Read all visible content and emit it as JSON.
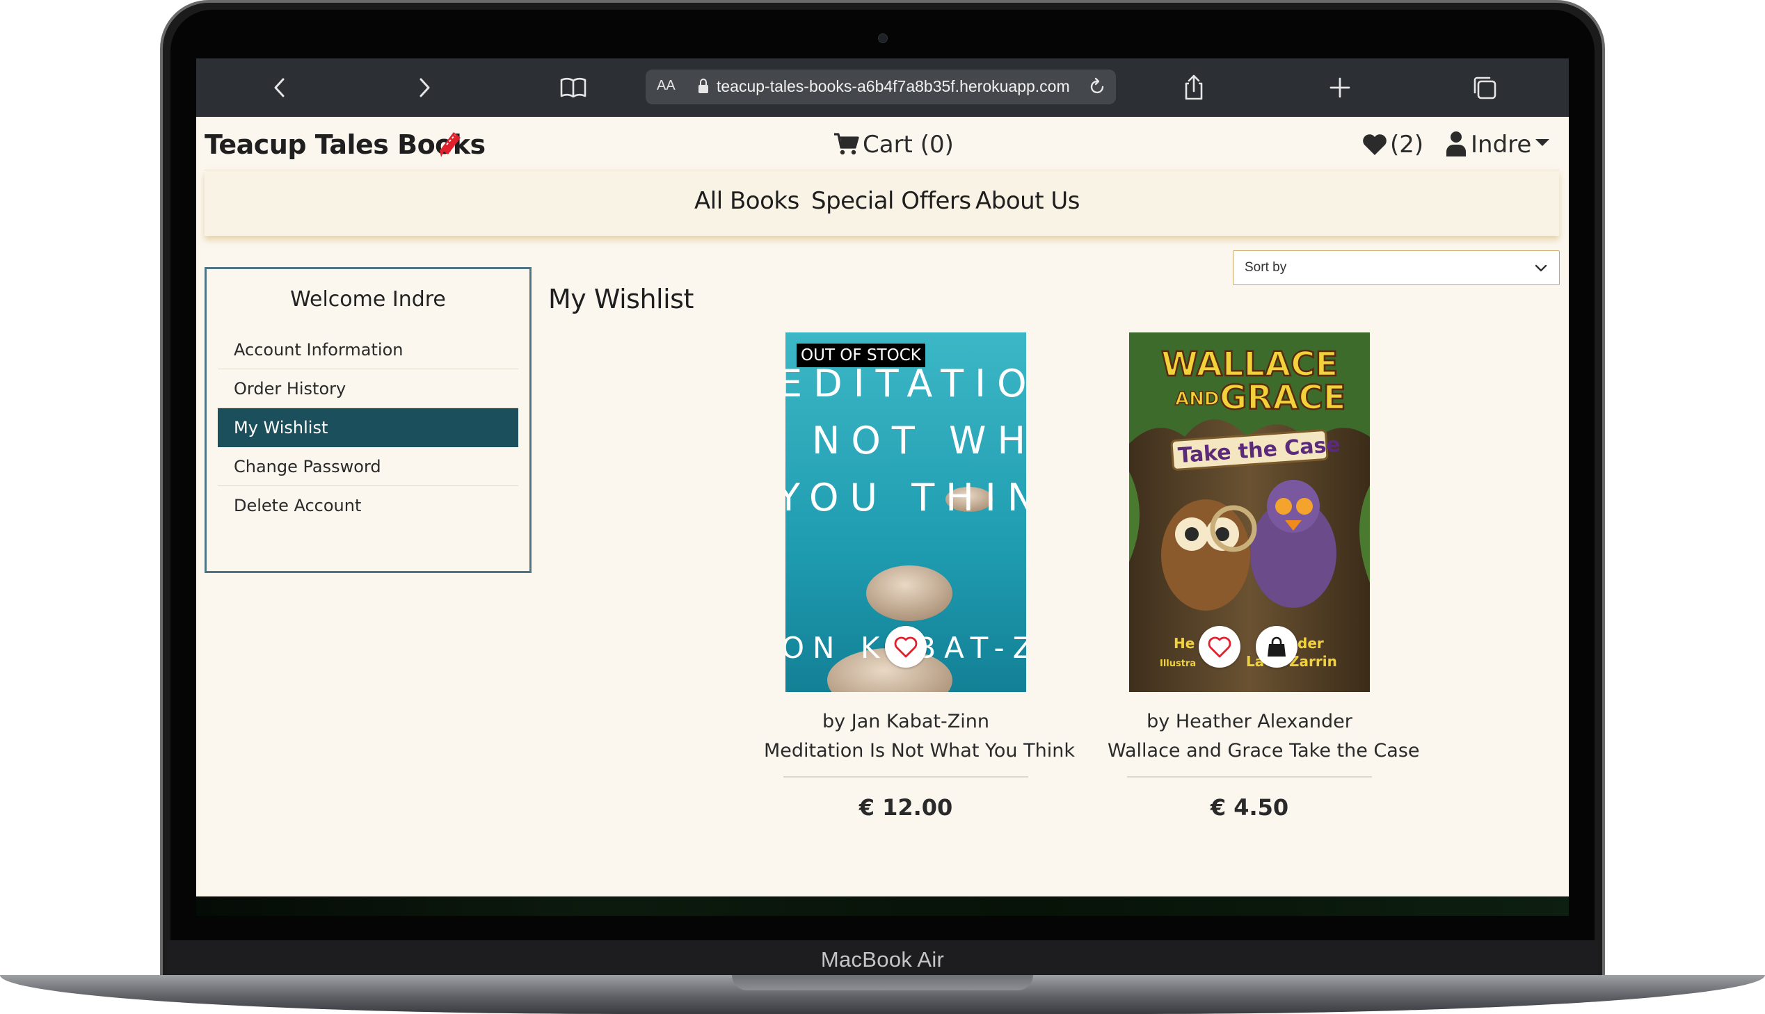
{
  "device": {
    "label": "MacBook Air"
  },
  "browser": {
    "text_size_label": "AA",
    "url": "teacup-tales-books-a6b4f7a8b35f.herokuapp.com",
    "icons": [
      "back-icon",
      "forward-icon",
      "bookmarks-icon",
      "lock-icon",
      "reload-icon",
      "share-icon",
      "new-tab-icon",
      "tabs-icon"
    ]
  },
  "header": {
    "brand": "Teacup Tales Books",
    "cart_label": "Cart (0)",
    "wishlist_label": "(2)",
    "user_label": "Indre"
  },
  "nav": {
    "links": [
      "All Books",
      "Special Offers",
      "About Us"
    ]
  },
  "sort": {
    "label": "Sort by"
  },
  "sidebar": {
    "title": "Welcome Indre",
    "items": [
      {
        "label": "Account Information",
        "active": false
      },
      {
        "label": "Order History",
        "active": false
      },
      {
        "label": "My Wishlist",
        "active": true
      },
      {
        "label": "Change Password",
        "active": false
      },
      {
        "label": "Delete Account",
        "active": false
      }
    ]
  },
  "main": {
    "title": "My Wishlist",
    "books": [
      {
        "badge": "OUT OF STOCK",
        "author": "by Jan Kabat-Zinn",
        "title": "Meditation Is Not What You Think",
        "price": "€ 12.00",
        "cover_text": [
          "EDITATIO",
          "NOT WHA",
          "YOU THINK",
          "ON KABAT-ZIN"
        ],
        "cover_color": "#2aa3b4"
      },
      {
        "author": "by Heather Alexander",
        "title": "Wallace and Grace Take the Case",
        "price": "€ 4.50",
        "cover_text": [
          "WALLACE",
          "AND",
          "GRACE",
          "Take the Case",
          "He",
          "der",
          "Illustra",
          "La",
          "Zarrin"
        ],
        "cover_color": "#5a4a2c"
      }
    ]
  },
  "colors": {
    "page_bg": "#fbf6ee",
    "accent": "#1c4f5c",
    "sidebar_border": "#4d7584",
    "heart": "#e0202a"
  }
}
